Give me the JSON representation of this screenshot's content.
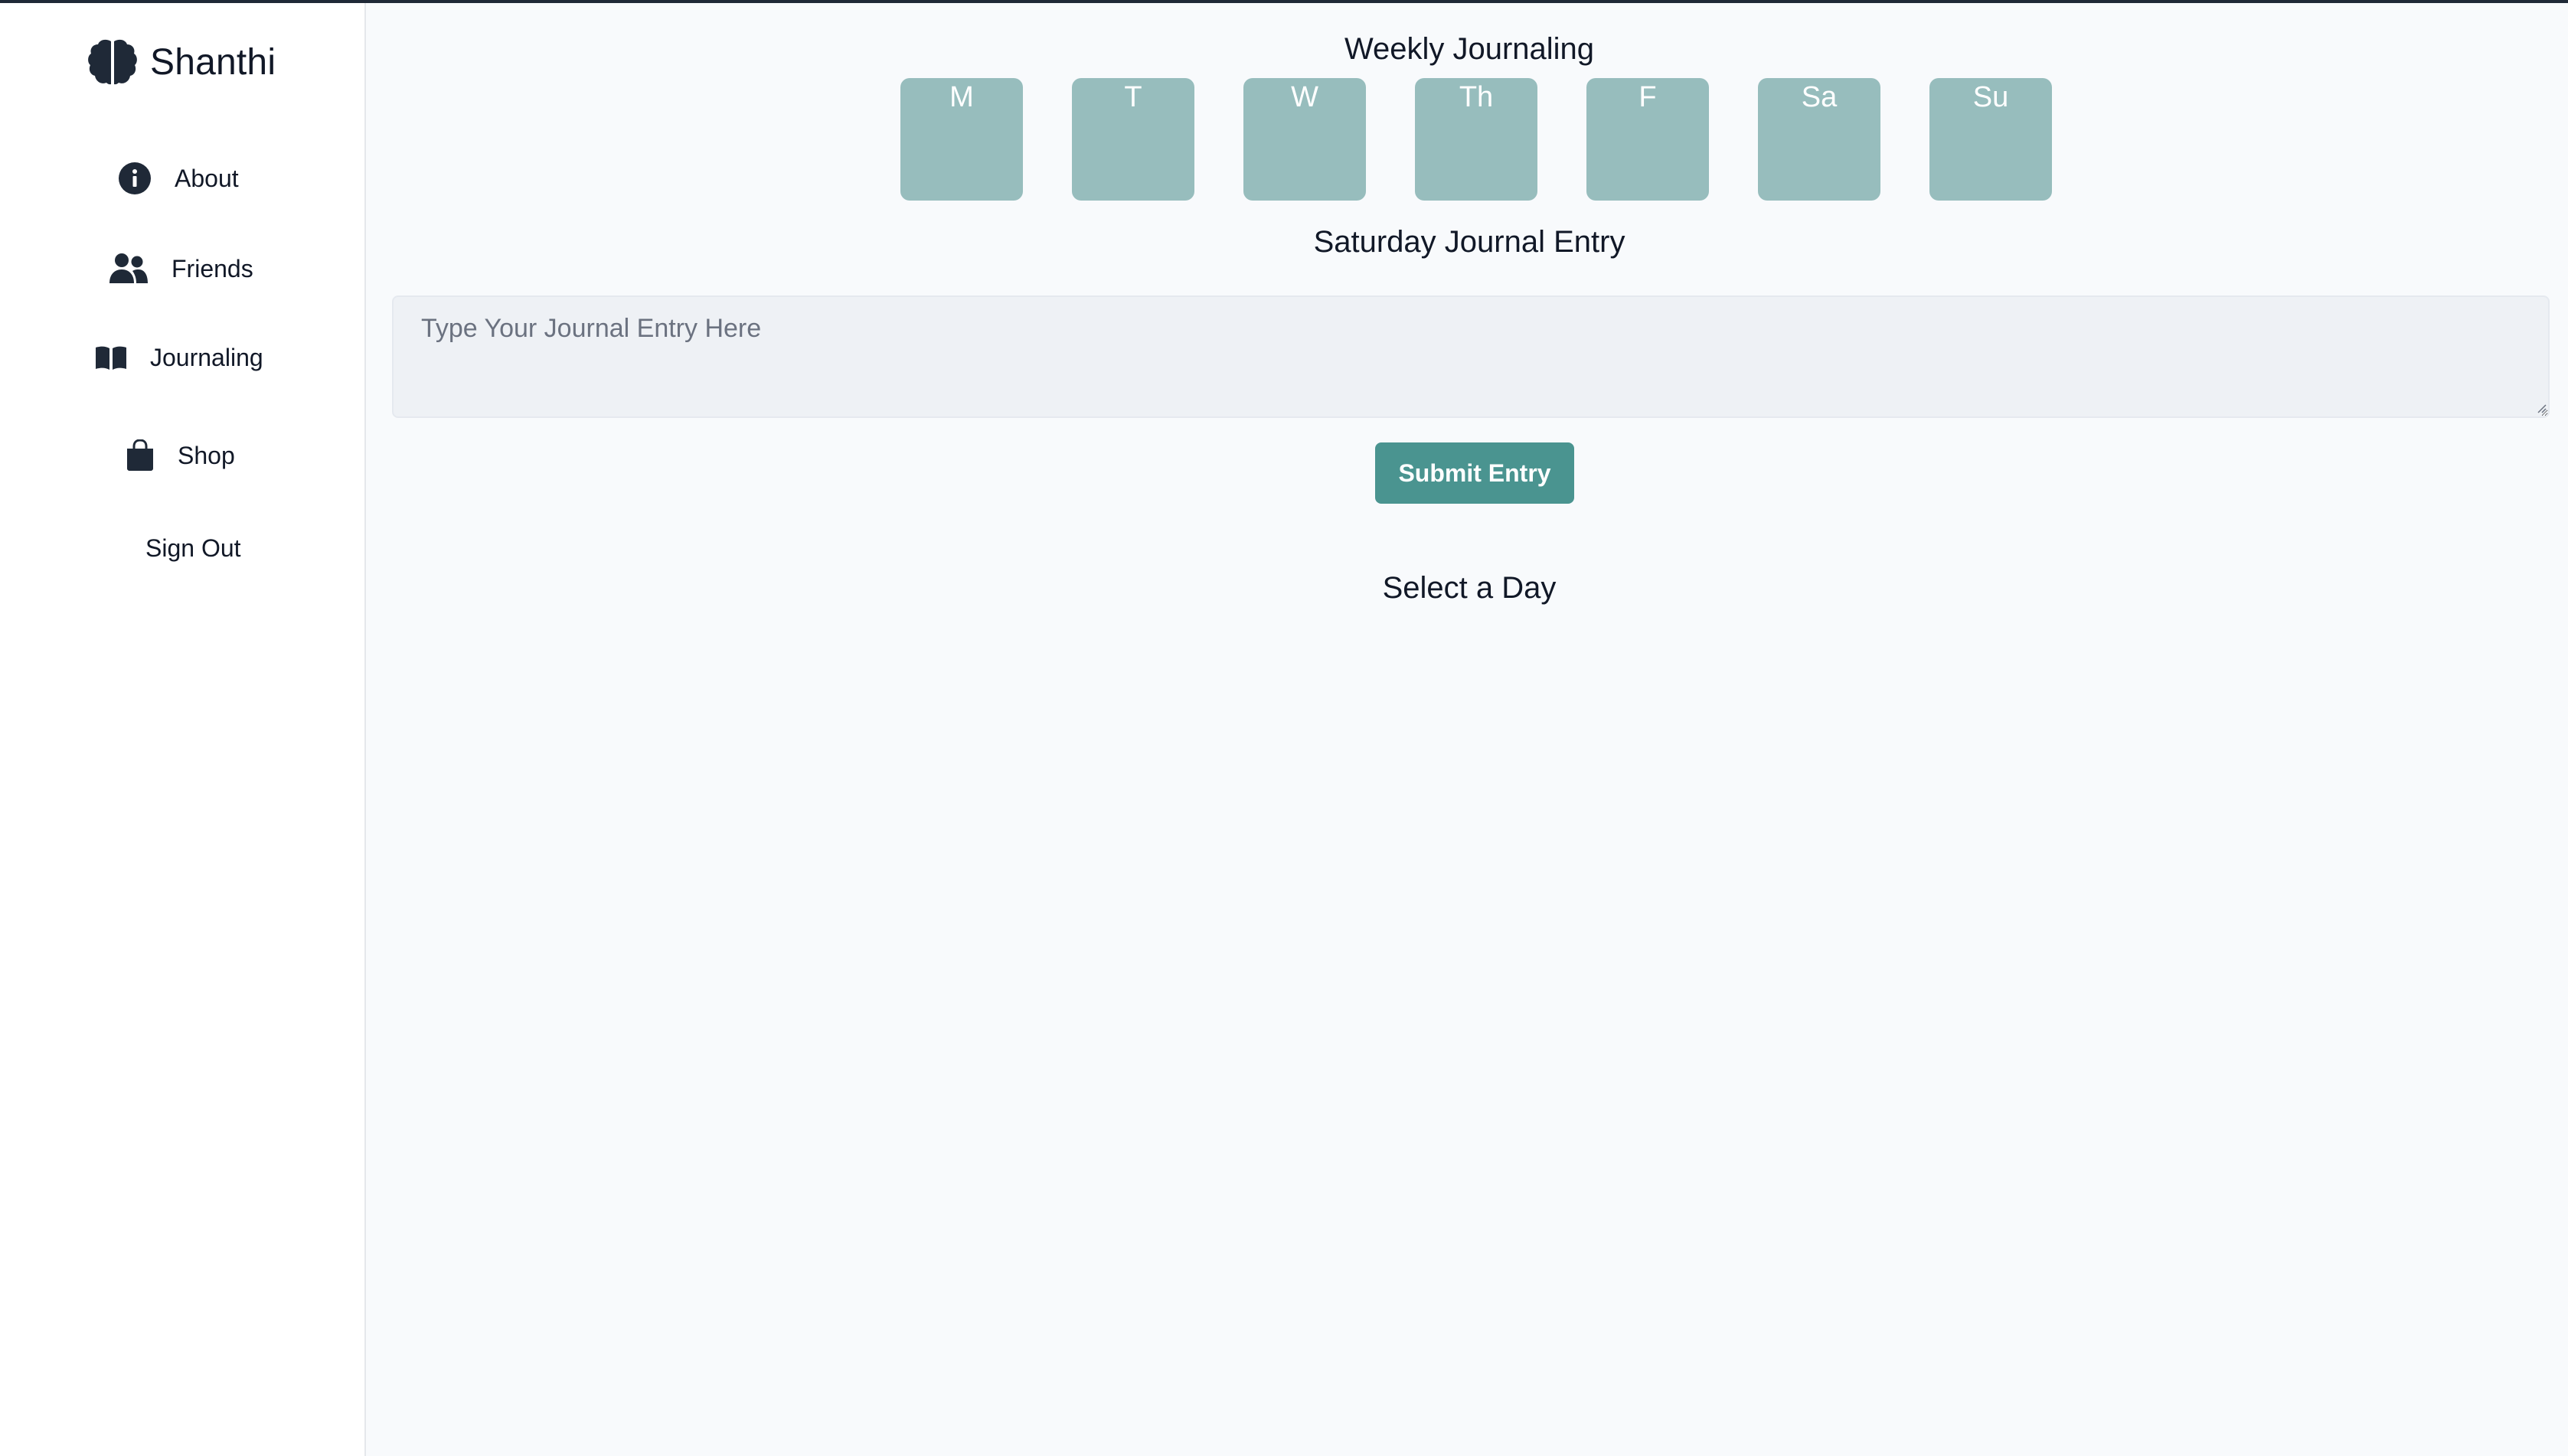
{
  "app": {
    "name": "Shanthi",
    "logo_icon": "brain-icon"
  },
  "sidebar": {
    "items": [
      {
        "label": "About",
        "icon": "info-icon"
      },
      {
        "label": "Friends",
        "icon": "users-icon"
      },
      {
        "label": "Journaling",
        "icon": "book-icon"
      },
      {
        "label": "Shop",
        "icon": "shopping-bag-icon"
      },
      {
        "label": "Sign Out",
        "icon": ""
      }
    ]
  },
  "main": {
    "title": "Weekly Journaling",
    "days": [
      "M",
      "T",
      "W",
      "Th",
      "F",
      "Sa",
      "Su"
    ],
    "entry_title": "Saturday Journal Entry",
    "entry_placeholder": "Type Your Journal Entry Here",
    "entry_value": "",
    "submit_label": "Submit Entry",
    "select_prompt": "Select a Day"
  },
  "colors": {
    "day_tile": "#97bdbd",
    "submit_button": "#4a9490",
    "background": "#f8fafc",
    "sidebar_bg": "#ffffff",
    "text": "#111827"
  }
}
